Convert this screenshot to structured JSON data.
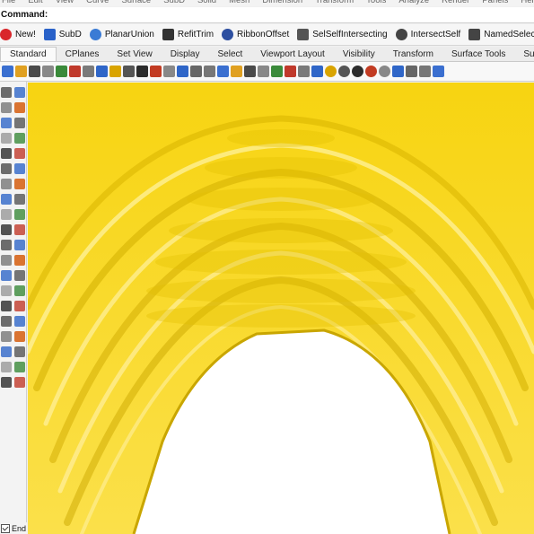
{
  "menu": [
    "File",
    "Edit",
    "View",
    "Curve",
    "Surface",
    "SubD",
    "Solid",
    "Mesh",
    "Dimension",
    "Transform",
    "Tools",
    "Analyze",
    "Render",
    "Panels",
    "Help"
  ],
  "command": {
    "label": "Command:"
  },
  "command_buttons": [
    {
      "label": "New!",
      "icon": "new-icon",
      "color": "#d9262b"
    },
    {
      "label": "SubD",
      "icon": "subd-icon",
      "color": "#2a62c9"
    },
    {
      "label": "PlanarUnion",
      "icon": "planar-union-icon",
      "color": "#3a7bd5"
    },
    {
      "label": "RefitTrim",
      "icon": "refit-trim-icon",
      "color": "#333333"
    },
    {
      "label": "RibbonOffset",
      "icon": "ribbon-offset-icon",
      "color": "#2d4fa0"
    },
    {
      "label": "SelSelfIntersecting",
      "icon": "sel-self-intersecting-icon",
      "color": "#555555"
    },
    {
      "label": "IntersectSelf",
      "icon": "intersect-self-icon",
      "color": "#444444"
    },
    {
      "label": "NamedSelections",
      "icon": "named-selections-icon",
      "color": "#444444"
    }
  ],
  "tabs": [
    {
      "label": "Standard",
      "active": true
    },
    {
      "label": "CPlanes",
      "active": false
    },
    {
      "label": "Set View",
      "active": false
    },
    {
      "label": "Display",
      "active": false
    },
    {
      "label": "Select",
      "active": false
    },
    {
      "label": "Viewport Layout",
      "active": false
    },
    {
      "label": "Visibility",
      "active": false
    },
    {
      "label": "Transform",
      "active": false
    },
    {
      "label": "Surface Tools",
      "active": false
    },
    {
      "label": "SubD Tools",
      "active": false
    }
  ],
  "toolbar_icons": [
    "new-file-icon",
    "open-icon",
    "save-icon",
    "print-icon",
    "import-icon",
    "cut-icon",
    "copy-icon",
    "paste-icon",
    "undo-icon",
    "pan-icon",
    "rotate-view-icon",
    "zoom-icon",
    "zoom-window-icon",
    "zoom-extents-icon",
    "zoom-selected-icon",
    "4-view-icon",
    "grid-icon",
    "points-on-icon",
    "curve-icon",
    "analyze-icon",
    "lock-icon",
    "light-icon",
    "layer-icon",
    "material-icon",
    "render-sphere-icon",
    "shaded-sphere-icon",
    "ghosted-sphere-icon",
    "xray-sphere-icon",
    "wireframe-sphere-icon",
    "pin-icon",
    "snap-icon",
    "grid-snap-icon",
    "arrow-more-icon"
  ],
  "left_tools": [
    "select-arrow-icon",
    "point-icon",
    "line-icon",
    "polyline-icon",
    "curve-icon",
    "arc-icon",
    "rectangle-icon",
    "circle-icon",
    "ellipse-icon",
    "polygon-icon",
    "freeform-icon",
    "fillet-icon",
    "extrude-icon",
    "loft-icon",
    "surface-icon",
    "patch-icon",
    "box-icon",
    "sphere-icon",
    "cylinder-icon",
    "cone-icon",
    "boolean-icon",
    "mesh-icon",
    "text-icon",
    "dimension-icon",
    "trim-icon",
    "split-icon",
    "join-icon",
    "explode-icon",
    "move-icon",
    "copy-icon",
    "rotate-icon",
    "scale-icon",
    "array-icon",
    "mirror-icon",
    "analyze-icon",
    "check-icon",
    "render-icon",
    "light-icon",
    "camera-icon",
    "paint-icon"
  ],
  "osnap": {
    "label": "End",
    "checked": true
  },
  "colors": {
    "model_yellow": "#fbdc1d",
    "shadow": "#c9a800",
    "highlight": "#fff2a0",
    "background": "#ffffff"
  }
}
